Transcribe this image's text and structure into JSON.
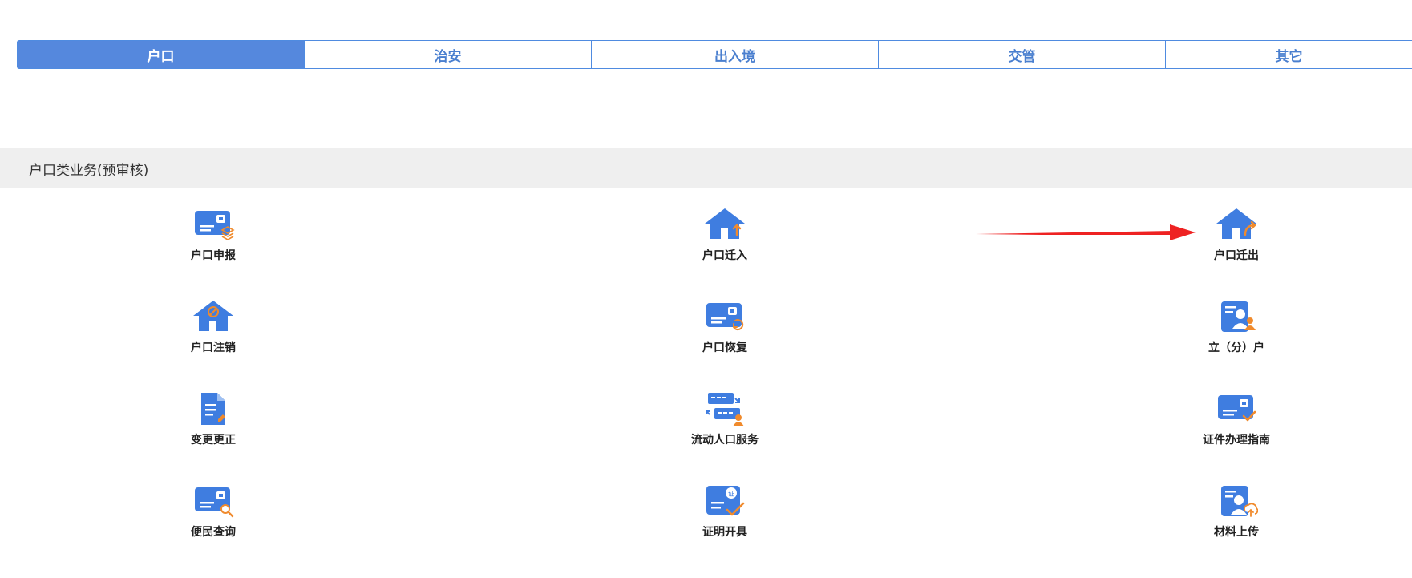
{
  "tabs": [
    {
      "label": "户口",
      "active": true
    },
    {
      "label": "治安",
      "active": false
    },
    {
      "label": "出入境",
      "active": false
    },
    {
      "label": "交管",
      "active": false
    },
    {
      "label": "其它",
      "active": false
    }
  ],
  "section": {
    "title": "户口类业务(预审核)"
  },
  "services": [
    {
      "label": "户口申报",
      "icon": "id-card-stack-icon"
    },
    {
      "label": "户口迁入",
      "icon": "house-arrow-in-icon"
    },
    {
      "label": "户口迁出",
      "icon": "house-arrow-out-icon"
    },
    {
      "label": "户口注销",
      "icon": "house-cancel-icon"
    },
    {
      "label": "户口恢复",
      "icon": "id-card-restore-icon"
    },
    {
      "label": "立（分）户",
      "icon": "person-doc-icon"
    },
    {
      "label": "变更更正",
      "icon": "document-edit-icon"
    },
    {
      "label": "流动人口服务",
      "icon": "cards-person-icon"
    },
    {
      "label": "证件办理指南",
      "icon": "id-card-check-icon"
    },
    {
      "label": "便民查询",
      "icon": "id-card-search-icon"
    },
    {
      "label": "证明开具",
      "icon": "certificate-check-icon"
    },
    {
      "label": "材料上传",
      "icon": "person-upload-icon"
    }
  ],
  "colors": {
    "accent": "#5588dd",
    "icon_blue": "#3f7de0",
    "icon_orange": "#f08a2c",
    "arrow_red": "#ee2222",
    "section_bg": "#efefef"
  }
}
